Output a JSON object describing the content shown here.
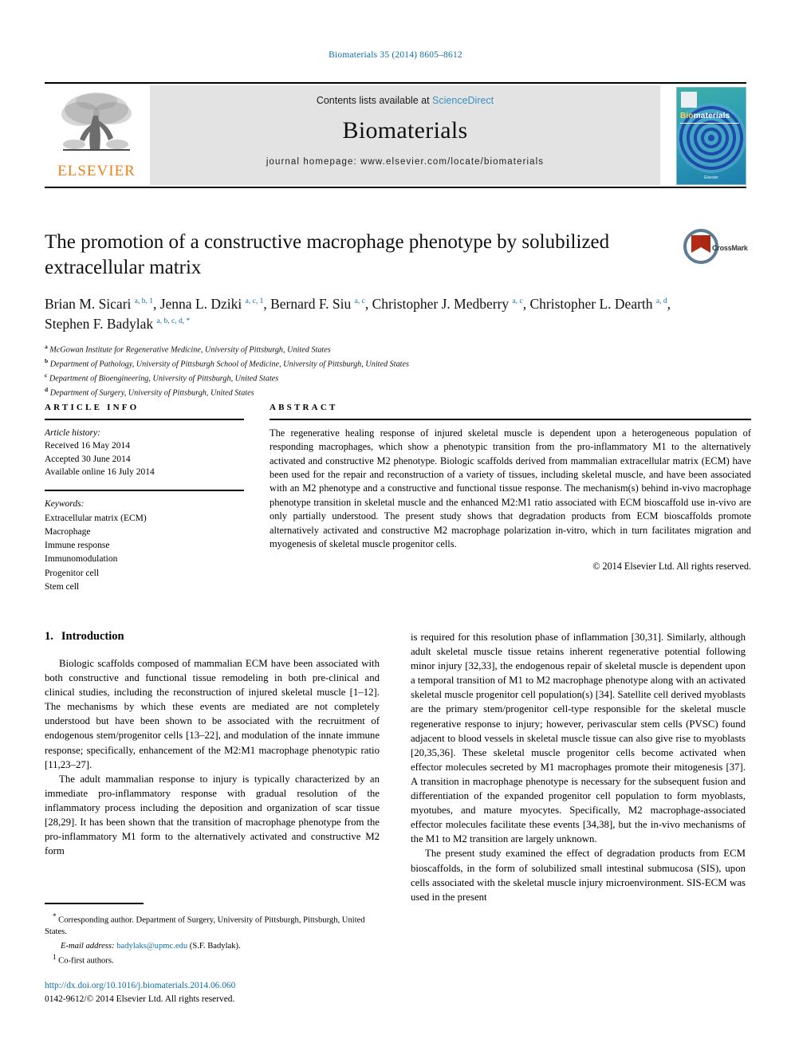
{
  "running_head": "Biomaterials 35 (2014) 8605–8612",
  "masthead": {
    "contents_prefix": "Contents lists available at ",
    "sciencedirect": "ScienceDirect",
    "journal_name": "Biomaterials",
    "homepage": "journal homepage: www.elsevier.com/locate/biomaterials",
    "publisher_wordmark": "ELSEVIER",
    "cover_brand_prefix": "Bio",
    "cover_brand_rest": "materials",
    "cover_footer": "Elsevier"
  },
  "crossmark": {
    "label": "CrossMark"
  },
  "article": {
    "title": "The promotion of a constructive macrophage phenotype by solubilized extracellular matrix",
    "authors_html": "Brian M. Sicari <sup>a, b, 1</sup>, Jenna L. Dziki <sup>a, c, 1</sup>, Bernard F. Siu <sup>a, c</sup>, Christopher J. Medberry <sup>a, c</sup>, Christopher L. Dearth <sup>a, d</sup>, Stephen F. Badylak <sup class=\"mix\">a, b, c, d, *</sup>",
    "affiliations": [
      {
        "label": "a",
        "text": "McGowan Institute for Regenerative Medicine, University of Pittsburgh, United States"
      },
      {
        "label": "b",
        "text": "Department of Pathology, University of Pittsburgh School of Medicine, University of Pittsburgh, United States"
      },
      {
        "label": "c",
        "text": "Department of Bioengineering, University of Pittsburgh, United States"
      },
      {
        "label": "d",
        "text": "Department of Surgery, University of Pittsburgh, United States"
      }
    ]
  },
  "article_info": {
    "heading": "ARTICLE INFO",
    "history_title": "Article history:",
    "history": [
      "Received 16 May 2014",
      "Accepted 30 June 2014",
      "Available online 16 July 2014"
    ],
    "keywords_title": "Keywords:",
    "keywords": [
      "Extracellular matrix (ECM)",
      "Macrophage",
      "Immune response",
      "Immunomodulation",
      "Progenitor cell",
      "Stem cell"
    ]
  },
  "abstract": {
    "heading": "ABSTRACT",
    "text": "The regenerative healing response of injured skeletal muscle is dependent upon a heterogeneous population of responding macrophages, which show a phenotypic transition from the pro-inflammatory M1 to the alternatively activated and constructive M2 phenotype. Biologic scaffolds derived from mammalian extracellular matrix (ECM) have been used for the repair and reconstruction of a variety of tissues, including skeletal muscle, and have been associated with an M2 phenotype and a constructive and functional tissue response. The mechanism(s) behind in-vivo macrophage phenotype transition in skeletal muscle and the enhanced M2:M1 ratio associated with ECM bioscaffold use in-vivo are only partially understood. The present study shows that degradation products from ECM bioscaffolds promote alternatively activated and constructive M2 macrophage polarization in-vitro, which in turn facilitates migration and myogenesis of skeletal muscle progenitor cells.",
    "copyright": "© 2014 Elsevier Ltd. All rights reserved."
  },
  "introduction": {
    "number": "1.",
    "heading": "Introduction",
    "left_paragraphs": [
      "Biologic scaffolds composed of mammalian ECM have been associated with both constructive and functional tissue remodeling in both pre-clinical and clinical studies, including the reconstruction of injured skeletal muscle [1–12]. The mechanisms by which these events are mediated are not completely understood but have been shown to be associated with the recruitment of endogenous stem/progenitor cells [13–22], and modulation of the innate immune response; specifically, enhancement of the M2:M1 macrophage phenotypic ratio [11,23–27].",
      "The adult mammalian response to injury is typically characterized by an immediate pro-inflammatory response with gradual resolution of the inflammatory process including the deposition and organization of scar tissue [28,29]. It has been shown that the transition of macrophage phenotype from the pro-inflammatory M1 form to the alternatively activated and constructive M2 form"
    ],
    "right_paragraphs": [
      "is required for this resolution phase of inflammation [30,31]. Similarly, although adult skeletal muscle tissue retains inherent regenerative potential following minor injury [32,33], the endogenous repair of skeletal muscle is dependent upon a temporal transition of M1 to M2 macrophage phenotype along with an activated skeletal muscle progenitor cell population(s) [34]. Satellite cell derived myoblasts are the primary stem/progenitor cell-type responsible for the skeletal muscle regenerative response to injury; however, perivascular stem cells (PVSC) found adjacent to blood vessels in skeletal muscle tissue can also give rise to myoblasts [20,35,36]. These skeletal muscle progenitor cells become activated when effector molecules secreted by M1 macrophages promote their mitogenesis [37]. A transition in macrophage phenotype is necessary for the subsequent fusion and differentiation of the expanded progenitor cell population to form myoblasts, myotubes, and mature myocytes. Specifically, M2 macrophage-associated effector molecules facilitate these events [34,38], but the in-vivo mechanisms of the M1 to M2 transition are largely unknown.",
      "The present study examined the effect of degradation products from ECM bioscaffolds, in the form of solubilized small intestinal submucosa (SIS), upon cells associated with the skeletal muscle injury microenvironment. SIS-ECM was used in the present"
    ]
  },
  "footnotes": {
    "corresponding": "Corresponding author. Department of Surgery, University of Pittsburgh, Pittsburgh, United States.",
    "email_label": "E-mail address:",
    "email": "badylaks@upmc.edu",
    "email_suffix": "(S.F. Badylak).",
    "cofirst_mark": "1",
    "cofirst": "Co-first authors."
  },
  "publication": {
    "doi": "http://dx.doi.org/10.1016/j.biomaterials.2014.06.060",
    "issn_line": "0142-9612/© 2014 Elsevier Ltd. All rights reserved."
  },
  "colors": {
    "link_blue": "#0b6ea8",
    "elsevier_orange": "#F07F1A",
    "band_gray": "#e3e3e3"
  }
}
